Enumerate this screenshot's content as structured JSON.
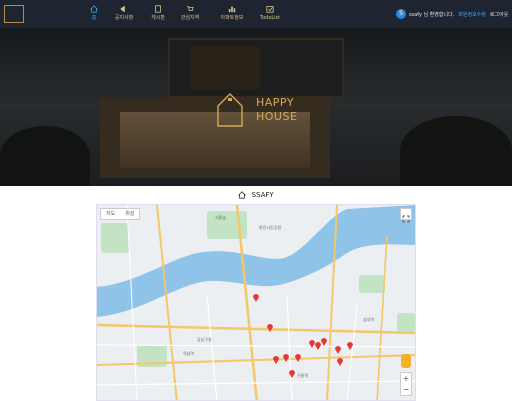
{
  "nav": {
    "items": [
      {
        "label": "홈",
        "icon": "home-icon",
        "active": true
      },
      {
        "label": "공지사항",
        "icon": "megaphone-icon",
        "active": false
      },
      {
        "label": "게시판",
        "icon": "board-icon",
        "active": false
      },
      {
        "label": "관심지역",
        "icon": "cart-icon",
        "active": false
      },
      {
        "label": "아파트정보",
        "icon": "bar-chart-icon",
        "active": false
      },
      {
        "label": "TodoList",
        "icon": "todo-icon",
        "active": false
      }
    ]
  },
  "user": {
    "avatar_letter": "S",
    "greeting": "ssafy 님 환영합니다.",
    "mypage": "회원정보수정",
    "logout": "로그아웃"
  },
  "hero": {
    "brand_line1": "HAPPY",
    "brand_line2": "HOUSE"
  },
  "section": {
    "title": "SSAFY"
  },
  "map": {
    "maptype": [
      "지도",
      "위성"
    ],
    "zoom_in": "+",
    "zoom_out": "−",
    "labels": [
      "한강시민공원",
      "서울숲",
      "강남구청",
      "선릉역",
      "삼성역",
      "역삼역"
    ]
  },
  "colors": {
    "nav_bg": "#1e2530",
    "nav_text": "#d8c48a",
    "active": "#3aa0e8",
    "brand": "#d6a85a",
    "marker": "#e53935"
  }
}
